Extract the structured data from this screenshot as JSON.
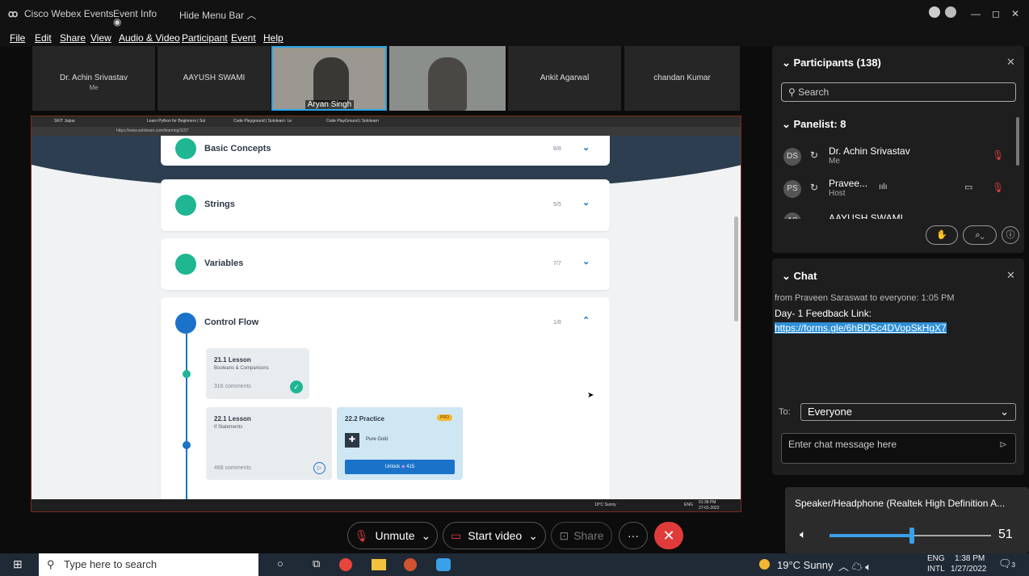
{
  "title_bar": {
    "app": "Cisco Webex Events",
    "event_info": "Event Info",
    "hide_menu": "Hide Menu Bar"
  },
  "menu": [
    "File",
    "Edit",
    "Share",
    "View",
    "Audio & Video",
    "Participant",
    "Event",
    "Help"
  ],
  "video_tiles": [
    {
      "name": "Dr. Achin Srivastav",
      "sub": "Me"
    },
    {
      "name": "AAYUSH SWAMI"
    },
    {
      "name": "Aryan Singh"
    },
    {
      "name": ""
    },
    {
      "name": "Ankit Agarwal"
    },
    {
      "name": "chandan Kumar"
    }
  ],
  "browser": {
    "tabs": [
      "SKIT Jaipur",
      "Learn Python for Beginners | Sol",
      "Code Playground | Sololearn: Le",
      "Code PlayGround | Sololearn"
    ],
    "url": "https://www.sololearn.com/learning/1157"
  },
  "course": {
    "modules": [
      {
        "title": "Basic Concepts",
        "progress": "8/8"
      },
      {
        "title": "Strings",
        "progress": "5/5"
      },
      {
        "title": "Variables",
        "progress": "7/7"
      },
      {
        "title": "Control Flow",
        "progress": "1/8"
      }
    ],
    "lessons": [
      {
        "label": "21.1 Lesson",
        "sub": "Booleans & Comparisons",
        "comments": "316 comments"
      },
      {
        "label": "22.1 Lesson",
        "sub": "If Statements",
        "comments": "468 comments"
      }
    ],
    "practice": {
      "label": "22.2 Practice",
      "badge": "PRO",
      "item": "Pure Gold",
      "unlock": "Unlock",
      "cost": "415"
    }
  },
  "shared_taskbar": {
    "weather": "19°C Sunny",
    "lang": "ENG",
    "time": "01:38 PM",
    "date": "27-01-2022"
  },
  "participants": {
    "title": "Participants (138)",
    "search_placeholder": "Search",
    "panelist_header": "Panelist: 8",
    "list": [
      {
        "initials": "DS",
        "name": "Dr. Achin Srivastav",
        "role": "Me"
      },
      {
        "initials": "PS",
        "name": "Pravee...",
        "role": "Host"
      },
      {
        "initials": "AS",
        "name": "AAYUSH SWAMI",
        "role": ""
      }
    ]
  },
  "chat": {
    "title": "Chat",
    "from": "from Praveen Saraswat to everyone:",
    "time": "1:05 PM",
    "message": "Day- 1 Feedback Link:",
    "link": "https://forms.gle/6hBDSc4DVopSkHgX7",
    "to_label": "To:",
    "to_value": "Everyone",
    "input_placeholder": "Enter chat message here"
  },
  "audio": {
    "device": "Speaker/Headphone (Realtek High Definition A...",
    "volume": "51",
    "volume_fraction": 0.51
  },
  "controls": {
    "unmute": "Unmute",
    "start_video": "Start video",
    "share": "Share",
    "more": "···"
  },
  "taskbar": {
    "search_placeholder": "Type here to search",
    "weather": "19°C Sunny",
    "lang_top": "ENG",
    "lang_bottom": "INTL",
    "time": "1:38 PM",
    "date": "1/27/2022",
    "notif": "3"
  }
}
